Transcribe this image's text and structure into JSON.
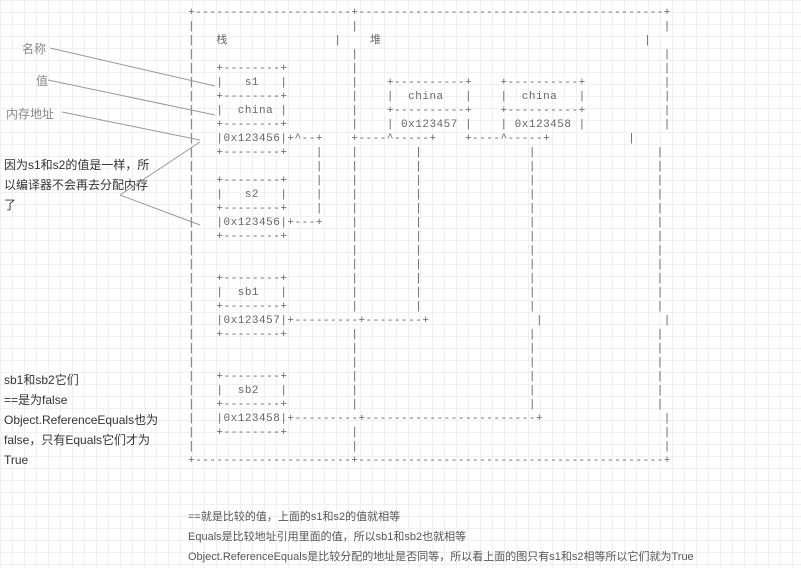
{
  "labels": {
    "name": "名称",
    "value": "值",
    "addr": "内存地址"
  },
  "annotation1": "因为s1和s2的值是一样，所以编译器不会再去分配内存了",
  "annotation2": "sb1和sb2它们\n==是为false\nObject.ReferenceEquals也为false，只有Equals它们才为True",
  "diagram": {
    "stack_header": "栈",
    "heap_header": "堆",
    "s1_name": "s1",
    "s1_value": "china",
    "s1_addr": "0x123456",
    "s2_name": "s2",
    "s2_addr": "0x123456",
    "sb1_name": "sb1",
    "sb1_addr": "0x123457",
    "sb2_name": "sb2",
    "sb2_addr": "0x123458",
    "heap_obj1_value": "china",
    "heap_obj1_addr": "0x123457",
    "heap_obj2_value": "china",
    "heap_obj2_addr": "0x123458"
  },
  "footnotes": {
    "f1": "==就是比较的值，上面的s1和s2的值就相等",
    "f2": "Equals是比较地址引用里面的值，所以sb1和sb2也就相等",
    "f3": "Object.ReferenceEquals是比较分配的地址是否同等，所以看上面的图只有s1和s2相等所以它们就为True"
  },
  "chart_data": {
    "type": "table",
    "title": "Memory diagram: stack vs heap for string comparison",
    "stack": [
      {
        "name": "s1",
        "value": "china",
        "address": "0x123456"
      },
      {
        "name": "s2",
        "value": null,
        "address": "0x123456"
      },
      {
        "name": "sb1",
        "value": null,
        "address": "0x123457",
        "points_to_heap": "0x123457"
      },
      {
        "name": "sb2",
        "value": null,
        "address": "0x123458",
        "points_to_heap": "0x123458"
      }
    ],
    "heap": [
      {
        "value": "china",
        "address": "0x123457"
      },
      {
        "value": "china",
        "address": "0x123458"
      }
    ],
    "notes": [
      "== compares values; s1 and s2 values are equal",
      "Equals compares referenced content; sb1 and sb2 are equal",
      "Object.ReferenceEquals compares allocated addresses; only s1 and s2 are equal so True"
    ]
  }
}
